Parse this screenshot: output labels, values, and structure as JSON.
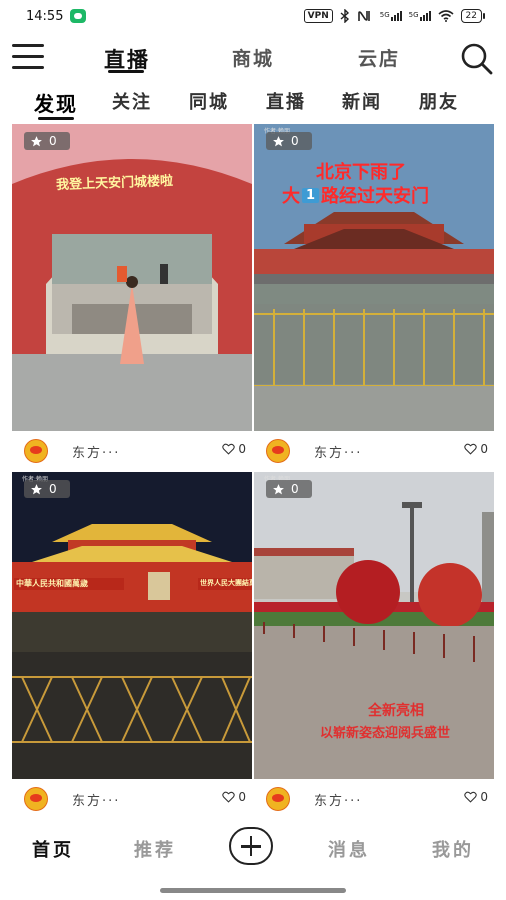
{
  "status": {
    "time": "14:55",
    "vpn": "VPN",
    "signal1": "5G",
    "signal2": "5G",
    "battery": "22",
    "icons": [
      "bluetooth-icon",
      "nfc-icon",
      "signal-icon",
      "wifi-icon"
    ]
  },
  "topnav": {
    "tabs": [
      "直播",
      "商城",
      "云店"
    ],
    "active_index": 0
  },
  "categories": {
    "tabs": [
      "发现",
      "关注",
      "同城",
      "直播",
      "新闻",
      "朋友"
    ],
    "active_index": 0
  },
  "cards": [
    {
      "stars": "0",
      "author": "东方···",
      "likes": "0",
      "overlay": "我登上天安门城楼啦"
    },
    {
      "stars": "0",
      "author": "东方···",
      "likes": "0",
      "overlay1": "北京下雨了",
      "overlay2a": "大",
      "overlay2num": "1",
      "overlay2b": "路经过天安门"
    },
    {
      "stars": "0",
      "author": "东方···",
      "likes": "0",
      "banner_left": "中華人民共和國萬歲",
      "banner_right": "世界人民大團結萬歲"
    },
    {
      "stars": "0",
      "author": "东方···",
      "likes": "0",
      "overlay1": "全新亮相",
      "overlay2": "以崭新姿态迎阅兵盛世"
    }
  ],
  "card_author_tag": "作者:赖朋",
  "bottomnav": {
    "items": [
      "首页",
      "推荐",
      "消息",
      "我的"
    ],
    "active_index": 0
  },
  "colors": {
    "accent": "#111111",
    "inactive": "#999999",
    "badge": "#5a5a5a"
  }
}
